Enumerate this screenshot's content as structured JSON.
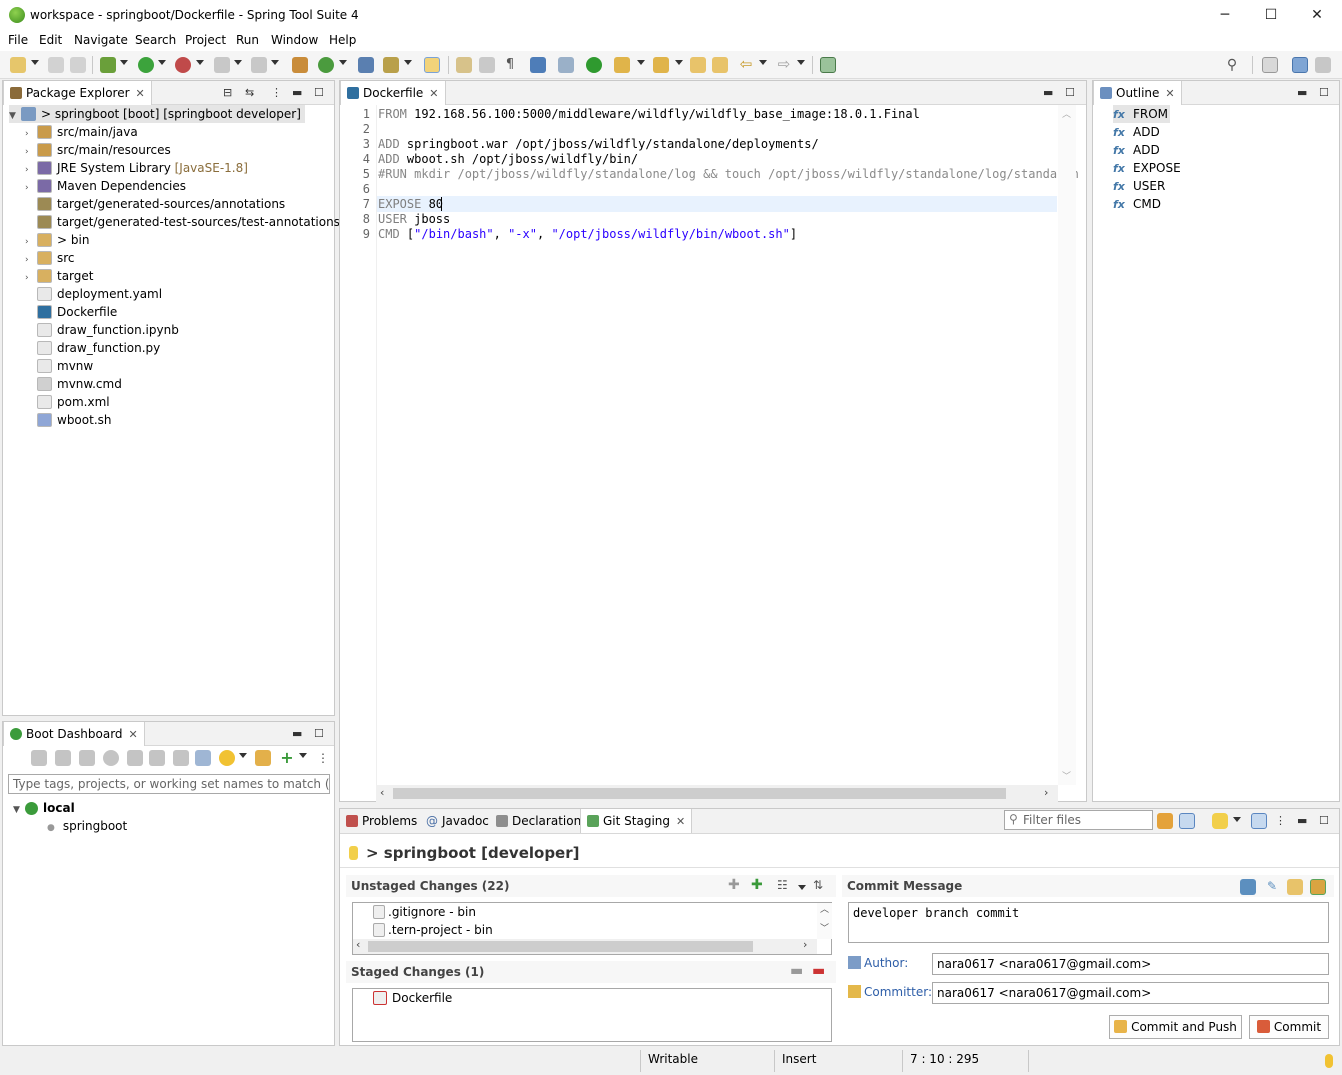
{
  "window": {
    "title": "workspace - springboot/Dockerfile - Spring Tool Suite 4",
    "controls": [
      "─",
      "☐",
      "✕"
    ]
  },
  "menu": [
    "File",
    "Edit",
    "Navigate",
    "Search",
    "Project",
    "Run",
    "Window",
    "Help"
  ],
  "package_explorer": {
    "tab_label": "Package Explorer",
    "root": "> springboot [boot] [springboot developer]",
    "items": [
      {
        "label": "src/main/java",
        "decor": ""
      },
      {
        "label": "src/main/resources",
        "decor": ""
      },
      {
        "label": "JRE System Library ",
        "decor": "[JavaSE-1.8]"
      },
      {
        "label": "Maven Dependencies",
        "decor": ""
      },
      {
        "label": "target/generated-sources/annotations",
        "decor": ""
      },
      {
        "label": "target/generated-test-sources/test-annotations",
        "decor": ""
      },
      {
        "label": "> bin",
        "decor": ""
      },
      {
        "label": "src",
        "decor": ""
      },
      {
        "label": "target",
        "decor": ""
      },
      {
        "label": "deployment.yaml",
        "decor": ""
      },
      {
        "label": "Dockerfile",
        "decor": ""
      },
      {
        "label": "draw_function.ipynb",
        "decor": ""
      },
      {
        "label": "draw_function.py",
        "decor": ""
      },
      {
        "label": "mvnw",
        "decor": ""
      },
      {
        "label": "mvnw.cmd",
        "decor": ""
      },
      {
        "label": "pom.xml",
        "decor": ""
      },
      {
        "label": "wboot.sh",
        "decor": ""
      }
    ]
  },
  "boot_dashboard": {
    "tab_label": "Boot Dashboard",
    "filter_placeholder": "Type tags, projects, or working set names to match (incl. *",
    "group": "local",
    "app": "springboot"
  },
  "editor": {
    "tab_label": "Dockerfile",
    "lines": [
      {
        "n": "1",
        "kw": "FROM",
        "rest": " 192.168.56.100:5000/middleware/wildfly/wildfly_base_image:18.0.1.Final"
      },
      {
        "n": "2",
        "kw": "",
        "rest": ""
      },
      {
        "n": "3",
        "kw": "ADD",
        "rest": " springboot.war /opt/jboss/wildfly/standalone/deployments/"
      },
      {
        "n": "4",
        "kw": "ADD",
        "rest": " wboot.sh /opt/jboss/wildfly/bin/"
      },
      {
        "n": "5",
        "kw": "",
        "rest": "#RUN mkdir /opt/jboss/wildfly/standalone/log && touch /opt/jboss/wildfly/standalone/log/standalon"
      },
      {
        "n": "6",
        "kw": "",
        "rest": ""
      },
      {
        "n": "7",
        "kw": "EXPOSE",
        "rest": " 80"
      },
      {
        "n": "8",
        "kw": "USER",
        "rest": " jboss"
      },
      {
        "n": "9",
        "kw": "CMD",
        "rest": " [\"/bin/bash\", \"-x\", \"/opt/jboss/wildfly/bin/wboot.sh\"]"
      }
    ]
  },
  "outline": {
    "tab_label": "Outline",
    "items": [
      "FROM",
      "ADD",
      "ADD",
      "EXPOSE",
      "USER",
      "CMD"
    ]
  },
  "bottom_tabs": {
    "problems": "Problems",
    "javadoc": "Javadoc",
    "declaration": "Declaration",
    "git_staging": "Git Staging",
    "filter_placeholder": "Filter files"
  },
  "git_staging": {
    "repo": "> springboot [developer]",
    "unstaged_header": "Unstaged Changes (22)",
    "unstaged": [
      ".gitignore - bin",
      ".tern-project - bin"
    ],
    "staged_header": "Staged Changes (1)",
    "staged": [
      "Dockerfile"
    ],
    "commit_message_header": "Commit Message",
    "commit_message": "developer branch commit",
    "author_label": "Author:",
    "author": "nara0617 <nara0617@gmail.com>",
    "committer_label": "Committer:",
    "committer": "nara0617 <nara0617@gmail.com>",
    "commit_and_push": "Commit and Push",
    "commit": "Commit"
  },
  "status_bar": {
    "mode": "Writable",
    "insert": "Insert",
    "position": "7 : 10 : 295"
  },
  "colors": {
    "keyword": "#7f7f7f",
    "string": "#2a00ff",
    "link": "#2e5ea8",
    "current_line": "#e8f2fe"
  }
}
